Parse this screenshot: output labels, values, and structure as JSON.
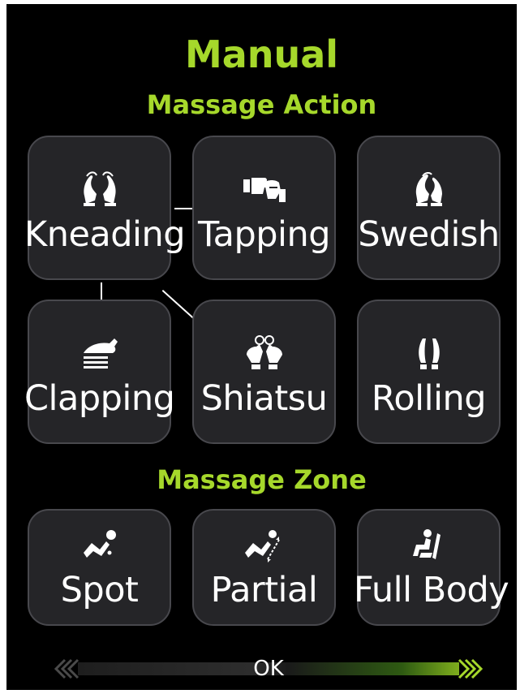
{
  "header": {
    "title": "Manual",
    "subtitle": "Massage Action"
  },
  "actions": [
    {
      "label": "Kneading",
      "icon": "kneading-hands-icon"
    },
    {
      "label": "Tapping",
      "icon": "tapping-fists-icon"
    },
    {
      "label": "Swedish",
      "icon": "swedish-hands-icon"
    },
    {
      "label": "Clapping",
      "icon": "clapping-hand-icon"
    },
    {
      "label": "Shiatsu",
      "icon": "shiatsu-thumbs-icon"
    },
    {
      "label": "Rolling",
      "icon": "rolling-rollers-icon"
    }
  ],
  "zone_section": {
    "title": "Massage Zone"
  },
  "zones": [
    {
      "label": "Spot",
      "icon": "spot-body-icon"
    },
    {
      "label": "Partial",
      "icon": "partial-body-icon"
    },
    {
      "label": "Full Body",
      "icon": "full-body-icon"
    }
  ],
  "ok_bar": {
    "label": "OK"
  },
  "colors": {
    "accent": "#a6d82b",
    "tile_bg": "#252528",
    "tile_border": "#48484d",
    "screen_bg": "#000000"
  }
}
